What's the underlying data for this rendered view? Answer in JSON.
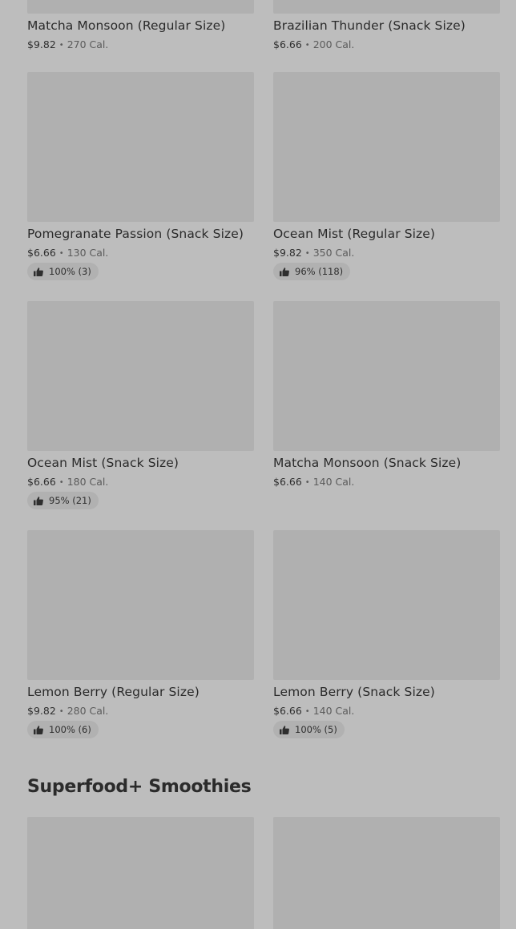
{
  "top_items": [
    {
      "name": "Matcha Monsoon (Regular Size)",
      "price": "$9.82",
      "calories": "270 Cal."
    },
    {
      "name": "Brazilian Thunder (Snack Size)",
      "price": "$6.66",
      "calories": "200 Cal."
    }
  ],
  "items": [
    {
      "name": "Pomegranate Passion (Snack Size)",
      "price": "$6.66",
      "calories": "130 Cal.",
      "rating": "100% (3)"
    },
    {
      "name": "Ocean Mist (Regular Size)",
      "price": "$9.82",
      "calories": "350 Cal.",
      "rating": "96% (118)"
    },
    {
      "name": "Ocean Mist (Snack Size)",
      "price": "$6.66",
      "calories": "180 Cal.",
      "rating": "95% (21)"
    },
    {
      "name": "Matcha Monsoon (Snack Size)",
      "price": "$6.66",
      "calories": "140 Cal."
    },
    {
      "name": "Lemon Berry (Regular Size)",
      "price": "$9.82",
      "calories": "280 Cal.",
      "rating": "100% (6)"
    },
    {
      "name": "Lemon Berry (Snack Size)",
      "price": "$6.66",
      "calories": "140 Cal.",
      "rating": "100% (5)"
    }
  ],
  "separator": "•",
  "sections": {
    "superfood_title": "Superfood+ Smoothies"
  },
  "icons": {
    "rating": "thumbs-up-icon"
  }
}
